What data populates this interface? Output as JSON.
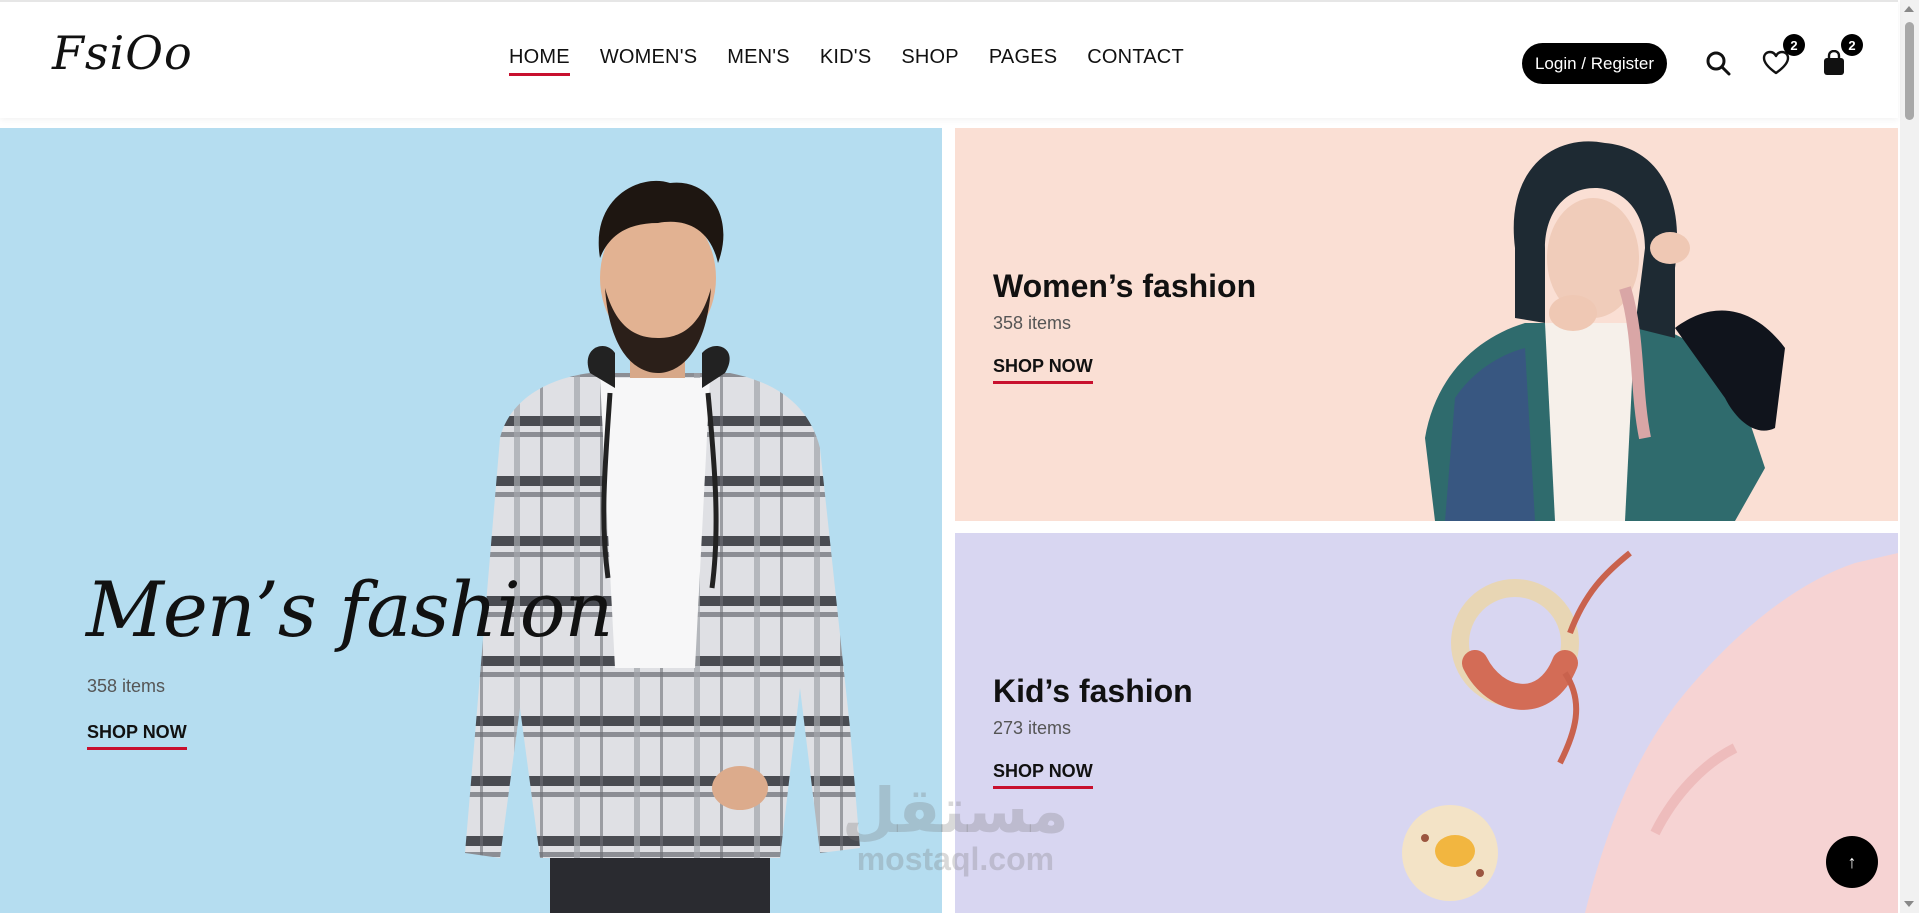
{
  "header": {
    "logo": "FsiOo",
    "nav": [
      {
        "label": "HOME",
        "active": true
      },
      {
        "label": "WOMEN'S"
      },
      {
        "label": "MEN'S"
      },
      {
        "label": "KID'S"
      },
      {
        "label": "SHOP"
      },
      {
        "label": "PAGES"
      },
      {
        "label": "CONTACT"
      }
    ],
    "login_label": "Login / Register",
    "icons": {
      "search": "search-icon",
      "wishlist": "heart-icon",
      "cart": "shopping-bag-icon"
    },
    "wishlist_count": "2",
    "cart_count": "2"
  },
  "banners": {
    "men": {
      "title": "Men’s fashion",
      "count": "358 items",
      "cta": "SHOP NOW",
      "bg": "#b5ddf0"
    },
    "women": {
      "title": "Women’s fashion",
      "count": "358 items",
      "cta": "SHOP NOW",
      "bg": "#fadfd4"
    },
    "kids": {
      "title": "Kid’s fashion",
      "count": "273 items",
      "cta": "SHOP NOW",
      "bg": "#d8d6f1"
    }
  },
  "watermark": {
    "arabic": "مستقل",
    "latin": "mostaql.com"
  },
  "back_to_top": {
    "icon": "arrow-up-icon",
    "glyph": "↑"
  },
  "colors": {
    "accent": "#c8102e",
    "dark": "#000000"
  }
}
